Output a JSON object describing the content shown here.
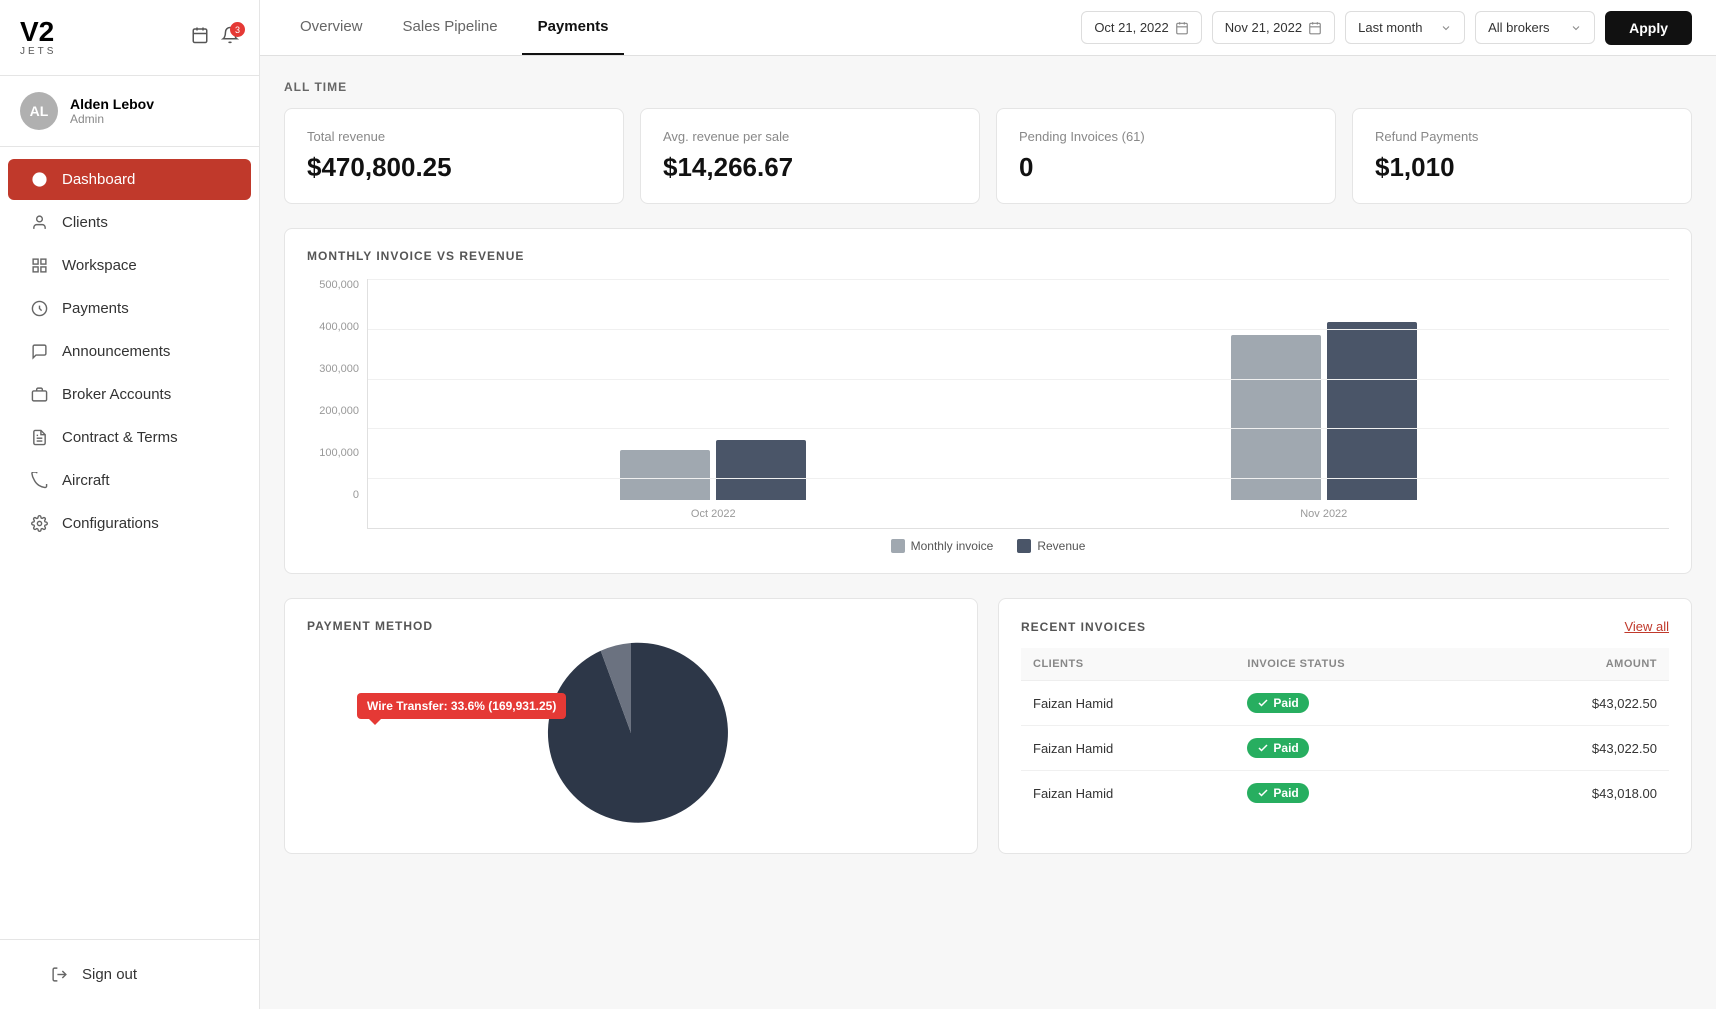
{
  "app": {
    "logo": "V2",
    "logo_sub": "JETS",
    "notification_count": "3"
  },
  "user": {
    "initials": "AL",
    "name": "Alden Lebov",
    "role": "Admin"
  },
  "sidebar": {
    "items": [
      {
        "id": "dashboard",
        "label": "Dashboard",
        "active": true
      },
      {
        "id": "clients",
        "label": "Clients"
      },
      {
        "id": "workspace",
        "label": "Workspace"
      },
      {
        "id": "payments",
        "label": "Payments"
      },
      {
        "id": "announcements",
        "label": "Announcements"
      },
      {
        "id": "broker-accounts",
        "label": "Broker Accounts"
      },
      {
        "id": "contract-terms",
        "label": "Contract & Terms"
      },
      {
        "id": "aircraft",
        "label": "Aircraft"
      },
      {
        "id": "configurations",
        "label": "Configurations"
      }
    ],
    "sign_out": "Sign out"
  },
  "header": {
    "tabs": [
      {
        "label": "Overview",
        "active": false
      },
      {
        "label": "Sales Pipeline",
        "active": false
      },
      {
        "label": "Payments",
        "active": true
      }
    ],
    "date_from": "Oct 21, 2022",
    "date_to": "Nov 21, 2022",
    "period_label": "Last month",
    "broker_label": "All brokers",
    "apply_label": "Apply"
  },
  "all_time": {
    "label": "ALL TIME",
    "cards": [
      {
        "label": "Total revenue",
        "value": "$470,800.25"
      },
      {
        "label": "Avg. revenue per sale",
        "value": "$14,266.67"
      },
      {
        "label": "Pending Invoices (61)",
        "value": "0"
      },
      {
        "label": "Refund Payments",
        "value": "$1,010"
      }
    ]
  },
  "chart": {
    "title": "MONTHLY INVOICE VS REVENUE",
    "y_labels": [
      "500,000",
      "400,000",
      "300,000",
      "200,000",
      "100,000",
      "0"
    ],
    "groups": [
      {
        "label": "Oct 2022",
        "monthly_invoice_height": 50,
        "revenue_height": 60
      },
      {
        "label": "Nov 2022",
        "monthly_invoice_height": 195,
        "revenue_height": 210
      }
    ],
    "legend": [
      {
        "label": "Monthly invoice",
        "color": "#a0a8b0"
      },
      {
        "label": "Revenue",
        "color": "#4a5568"
      }
    ]
  },
  "payment_method": {
    "title": "PAYMENT METHOD",
    "tooltip": "Wire Transfer: 33.6% (169,931.25)"
  },
  "recent_invoices": {
    "title": "RECENT INVOICES",
    "view_all": "View all",
    "columns": [
      "CLIENTS",
      "INVOICE STATUS",
      "AMOUNT"
    ],
    "rows": [
      {
        "client": "Faizan Hamid",
        "status": "Paid",
        "amount": "$43,022.50"
      },
      {
        "client": "Faizan Hamid",
        "status": "Paid",
        "amount": "$43,022.50"
      },
      {
        "client": "Faizan Hamid",
        "status": "Paid",
        "amount": "$43,018.00"
      }
    ]
  }
}
